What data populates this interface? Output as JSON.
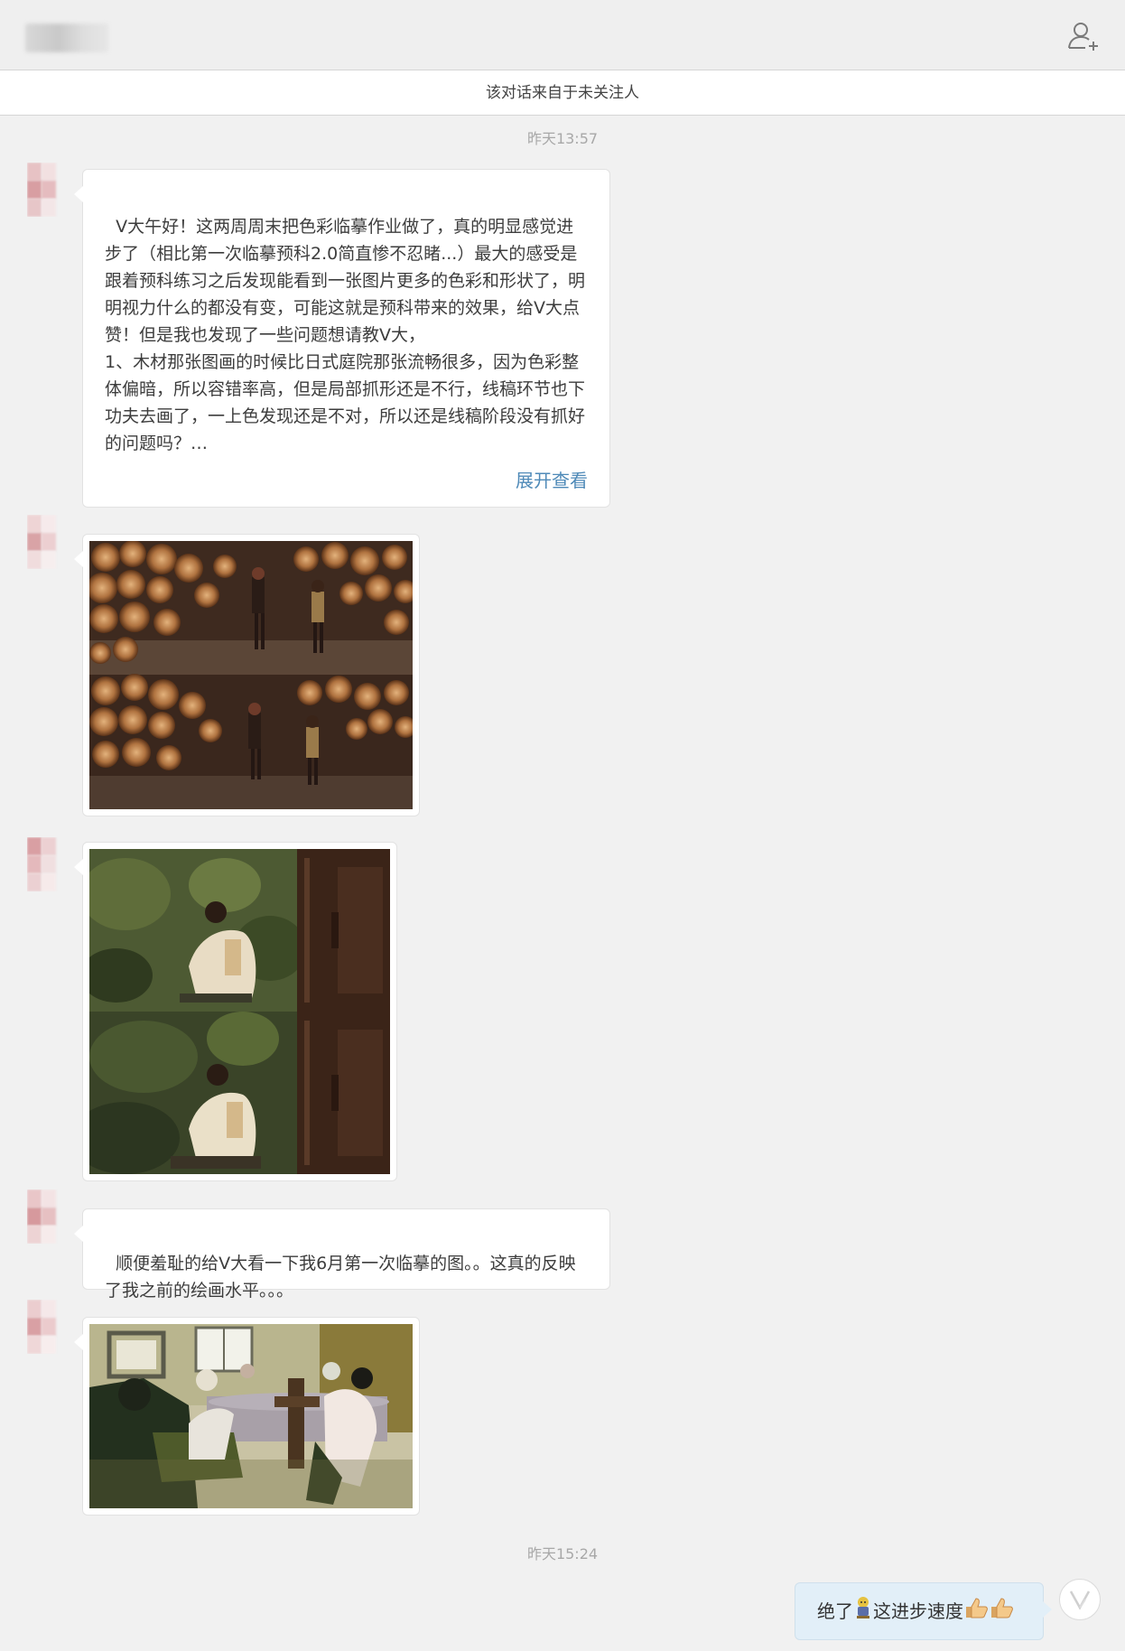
{
  "header": {
    "notice": "该对话来自于未关注人",
    "add_user_icon": "add-user-icon"
  },
  "timestamps": {
    "first": "昨天13:57",
    "second": "昨天15:24"
  },
  "messages": {
    "text1": "V大午好！这两周周末把色彩临摹作业做了，真的明显感觉进步了（相比第一次临摹预科2.0简直惨不忍睹...）最大的感受是跟着预科练习之后发现能看到一张图片更多的色彩和形状了，明明视力什么的都没有变，可能这就是预科带来的效果，给V大点赞！但是我也发现了一些问题想请教V大，\n1、木材那张图画的时候比日式庭院那张流畅很多，因为色彩整体偏暗，所以容错率高，但是局部抓形还是不行，线稿环节也下功夫去画了，一上色发现还是不对，所以还是线稿阶段没有抓好的问题吗？…",
    "expand_label": "展开查看",
    "text2": "顺便羞耻的给V大看一下我6月第一次临摹的图。。这真的反映了我之前的绘画水平。。。",
    "reply_prefix": "绝了",
    "reply_middle": "这进步速度"
  },
  "colors": {
    "link": "#4f8ab8",
    "timestamp": "#a8a8a8",
    "sent_bubble": "#e2eff8"
  }
}
